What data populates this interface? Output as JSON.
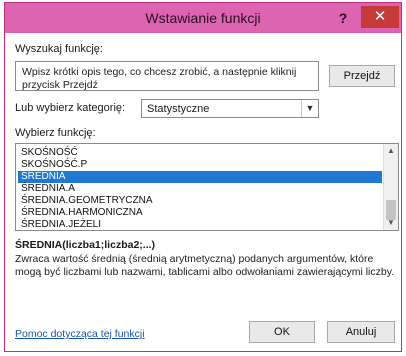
{
  "window": {
    "title": "Wstawianie funkcji",
    "help_glyph": "?",
    "close_glyph": "✕"
  },
  "search": {
    "label": "Wyszukaj funkcję:",
    "placeholder": "Wpisz krótki opis tego, co chcesz zrobić, a następnie kliknij przycisk Przejdź",
    "go_button": "Przejdź"
  },
  "category": {
    "label": "Lub wybierz kategorię:",
    "selected": "Statystyczne"
  },
  "functions": {
    "label": "Wybierz funkcję:",
    "items": [
      "SKOŚNOŚĆ",
      "SKOŚNOŚĆ.P",
      "ŚREDNIA",
      "ŚREDNIA.A",
      "ŚREDNIA.GEOMETRYCZNA",
      "ŚREDNIA.HARMONICZNA",
      "ŚREDNIA.JEŻELI"
    ],
    "selected_index": 2
  },
  "details": {
    "signature": "ŚREDNIA(liczba1;liczba2;...)",
    "description": "Zwraca wartość średnią (średnią arytmetyczną) podanych argumentów, które mogą być liczbami lub nazwami, tablicami albo odwołaniami zawierającymi liczby."
  },
  "footer": {
    "help_link": "Pomoc dotycząca tej funkcji",
    "ok": "OK",
    "cancel": "Anuluj"
  },
  "colors": {
    "titlebar": "#dd64b0",
    "close": "#c73a3a",
    "selection": "#1f78d1",
    "link": "#1a56a8"
  }
}
